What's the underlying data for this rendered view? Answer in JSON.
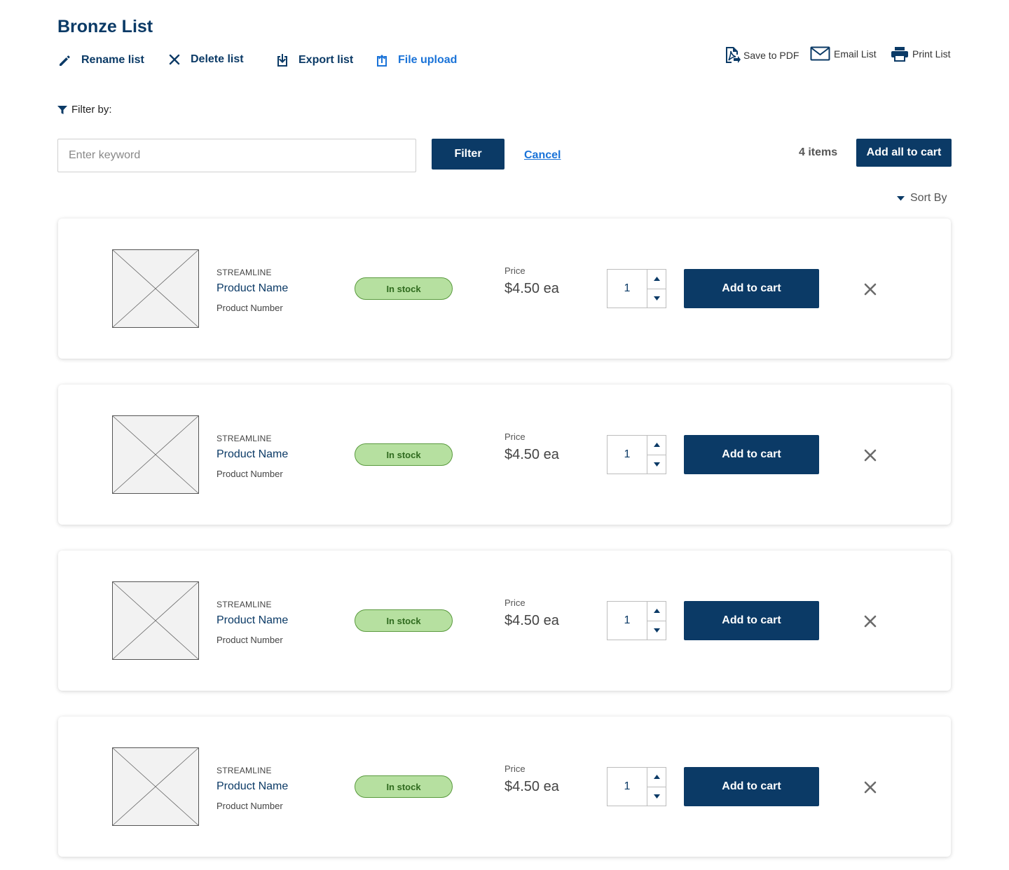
{
  "page": {
    "title": "Bronze List"
  },
  "actions": {
    "rename": "Rename list",
    "delete": "Delete list",
    "export": "Export list",
    "upload": "File upload"
  },
  "utilities": {
    "save_pdf": "Save to PDF",
    "email": "Email List",
    "print": "Print List"
  },
  "filter": {
    "label": "Filter by:",
    "placeholder": "Enter keyword",
    "value": "",
    "button": "Filter",
    "cancel": "Cancel"
  },
  "summary": {
    "count": "4 items",
    "add_all": "Add all to cart"
  },
  "sort": {
    "label": "Sort By"
  },
  "items": [
    {
      "brand": "STREAMLINE",
      "name": "Product Name",
      "number": "Product Number",
      "stock": "In stock",
      "price_label": "Price",
      "price": "$4.50 ea",
      "qty": "1",
      "add": "Add to cart"
    },
    {
      "brand": "STREAMLINE",
      "name": "Product Name",
      "number": "Product Number",
      "stock": "In stock",
      "price_label": "Price",
      "price": "$4.50 ea",
      "qty": "1",
      "add": "Add to cart"
    },
    {
      "brand": "STREAMLINE",
      "name": "Product Name",
      "number": "Product Number",
      "stock": "In stock",
      "price_label": "Price",
      "price": "$4.50 ea",
      "qty": "1",
      "add": "Add to cart"
    },
    {
      "brand": "STREAMLINE",
      "name": "Product Name",
      "number": "Product Number",
      "stock": "In stock",
      "price_label": "Price",
      "price": "$4.50 ea",
      "qty": "1",
      "add": "Add to cart"
    }
  ],
  "icons": {
    "rename": "pencil-icon",
    "delete": "close-icon",
    "export": "download-icon",
    "upload": "upload-icon",
    "pdf": "pdf-icon",
    "email": "envelope-icon",
    "print": "printer-icon",
    "filter": "funnel-icon",
    "sort": "caret-down-icon",
    "remove": "close-icon",
    "thumbnail": "image-placeholder-icon"
  },
  "colors": {
    "primary": "#0b3a66",
    "link": "#1a73d8",
    "stock_bg": "#b6e0a0",
    "stock_border": "#5a9a3e"
  }
}
